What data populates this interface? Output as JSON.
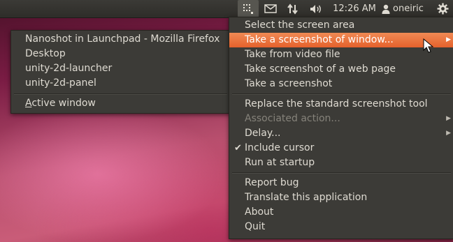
{
  "top_panel": {
    "indicators": [
      {
        "name": "nanoshot-icon"
      },
      {
        "name": "mail-icon"
      },
      {
        "name": "network-icon"
      },
      {
        "name": "sound-icon"
      }
    ],
    "clock": "12:26 AM",
    "username": "oneiric",
    "user_icon": "user-icon",
    "session_icon": "gear-icon"
  },
  "main_menu": {
    "items": [
      {
        "label": "Select the screen area"
      },
      {
        "label": "Take a screenshot of window...",
        "highlighted": true,
        "submenu": true
      },
      {
        "label": "Take from video file"
      },
      {
        "label": "Take screenshot of a web page"
      },
      {
        "label": "Take a screenshot"
      },
      {
        "label": "Replace the standard screenshot tool"
      },
      {
        "label": "Associated action...",
        "disabled": true
      },
      {
        "label": "Delay...",
        "submenu": true
      },
      {
        "label": "Include cursor",
        "checked": true
      },
      {
        "label": "Run at startup"
      },
      {
        "label": "Report bug"
      },
      {
        "label": "Translate this application"
      },
      {
        "label": "About"
      },
      {
        "label": "Quit"
      }
    ]
  },
  "window_submenu": {
    "items": [
      {
        "label": "Nanoshot in Launchpad - Mozilla Firefox"
      },
      {
        "label": "Desktop"
      },
      {
        "label": "unity-2d-launcher"
      },
      {
        "label": "unity-2d-panel"
      },
      {
        "label_mnemonic": "A",
        "label_rest": "ctive window"
      }
    ]
  },
  "colors": {
    "panel_bg": "#3b3a36",
    "menu_bg": "#3c3b37",
    "highlight": "#e5612c",
    "text": "#dfdbd2",
    "disabled_text": "#85827a"
  }
}
